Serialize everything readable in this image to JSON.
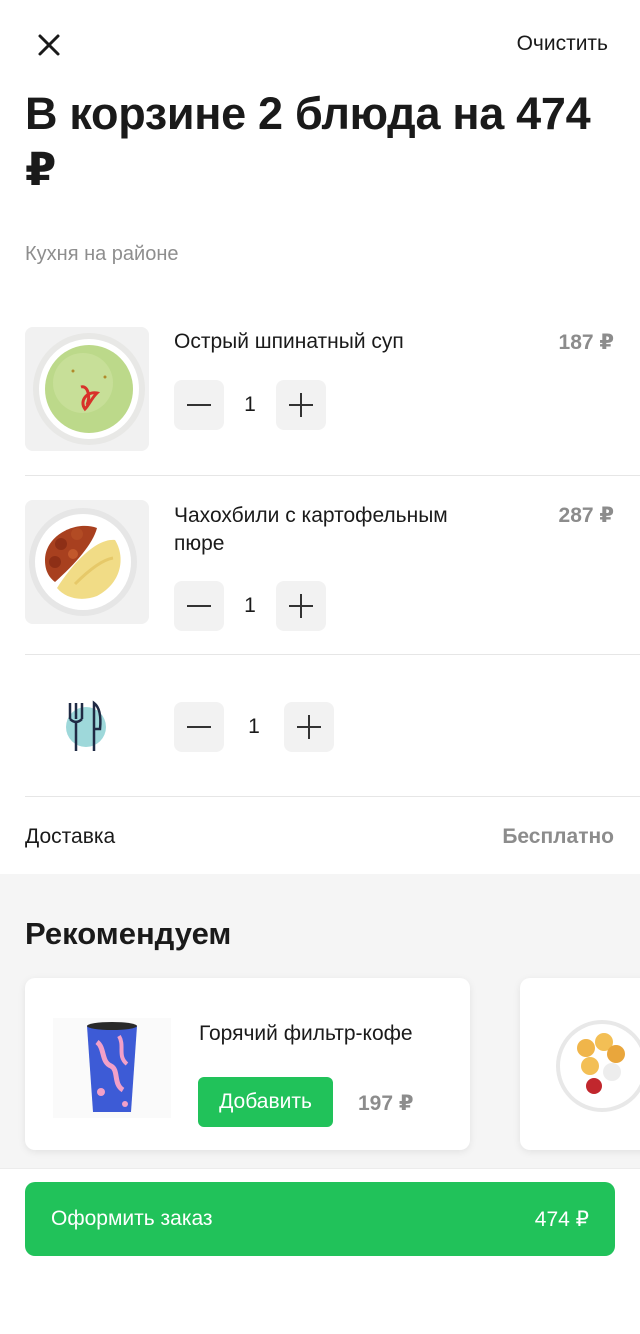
{
  "header": {
    "clear_label": "Очистить",
    "close_icon": "close-icon"
  },
  "title": "В корзине 2 блюда на 474 ₽",
  "restaurant": "Кухня на районе",
  "items": [
    {
      "name": "Острый шпинатный суп",
      "price": "187 ₽",
      "qty": "1",
      "image": "spinach-soup-bowl"
    },
    {
      "name": "Чахохбили с картофельным пюре",
      "price": "287 ₽",
      "qty": "1",
      "image": "chakhokhbili-plate"
    }
  ],
  "cutlery": {
    "qty": "1",
    "icon": "cutlery-icon"
  },
  "delivery": {
    "label": "Доставка",
    "value": "Бесплатно"
  },
  "recommend": {
    "title": "Рекомендуем",
    "cards": [
      {
        "name": "Горячий фильтр-кофе",
        "add_label": "Добавить",
        "price": "197 ₽",
        "image": "coffee-cup"
      }
    ]
  },
  "checkout": {
    "label": "Оформить заказ",
    "total": "474 ₽"
  },
  "colors": {
    "accent_green": "#21c25a",
    "muted_gray": "#8c8c8c",
    "step_bg": "#f2f2f2"
  }
}
